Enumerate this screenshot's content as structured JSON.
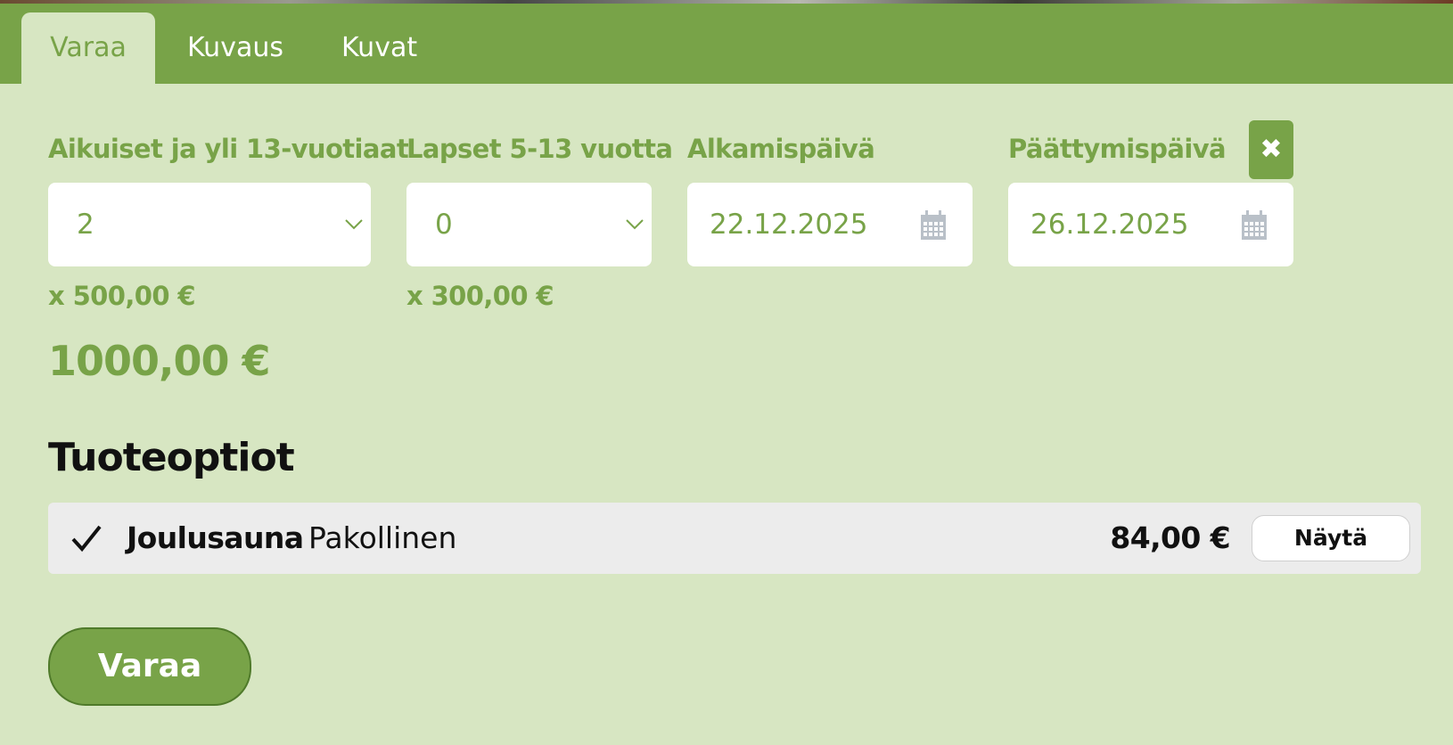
{
  "tabs": [
    {
      "label": "Varaa",
      "active": true
    },
    {
      "label": "Kuvaus",
      "active": false
    },
    {
      "label": "Kuvat",
      "active": false
    }
  ],
  "booking": {
    "adults": {
      "label": "Aikuiset ja yli 13-vuotiaat",
      "value": "2",
      "unit_price": "x 500,00 €"
    },
    "children": {
      "label": "Lapset 5-13 vuotta",
      "value": "0",
      "unit_price": "x 300,00 €"
    },
    "start_date": {
      "label": "Alkamispäivä",
      "value": "22.12.2025"
    },
    "end_date": {
      "label": "Päättymispäivä",
      "value": "26.12.2025"
    },
    "clear_icon": "✖",
    "total": "1000,00 €"
  },
  "options": {
    "title": "Tuoteoptiot",
    "items": [
      {
        "check": "✓",
        "name": "Joulusauna",
        "requirement": "Pakollinen",
        "price": "84,00 €",
        "button": "Näytä"
      }
    ]
  },
  "submit_label": "Varaa",
  "colors": {
    "accent": "#78a348",
    "panel_bg": "#d7e6c2",
    "option_bg": "#ececec",
    "text_dark": "#111111"
  },
  "icons": [
    "clear-icon",
    "chevron-down-icon",
    "calendar-icon",
    "check-icon"
  ]
}
